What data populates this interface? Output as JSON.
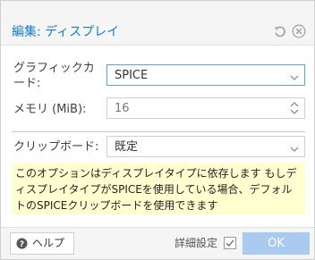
{
  "dialog": {
    "title": "編集: ディスプレイ"
  },
  "form": {
    "graphics_card_label": "グラフィックカード:",
    "graphics_card_value": "SPICE",
    "memory_label": "メモリ (MiB):",
    "memory_placeholder": "16",
    "clipboard_label": "クリップボード:",
    "clipboard_value": "既定",
    "notice": "このオプションはディスプレイタイプに依存します もしディスプレイタイプがSPICEを使用している場合、デフォルトのSPICEクリップボードを使用できます"
  },
  "footer": {
    "help_label": "ヘルプ",
    "advanced_label": "詳細設定",
    "advanced_checked": true,
    "ok_label": "OK"
  },
  "icons": {
    "reset": "reset-icon",
    "close": "close-icon",
    "help": "help-icon",
    "dropdown": "chevron-down-icon",
    "spinner": "spinner-icon"
  },
  "colors": {
    "title": "#157fcc",
    "focus_border": "#5fa2dd",
    "notice_bg": "#ffffd0",
    "ok_button": "#aacbef"
  }
}
